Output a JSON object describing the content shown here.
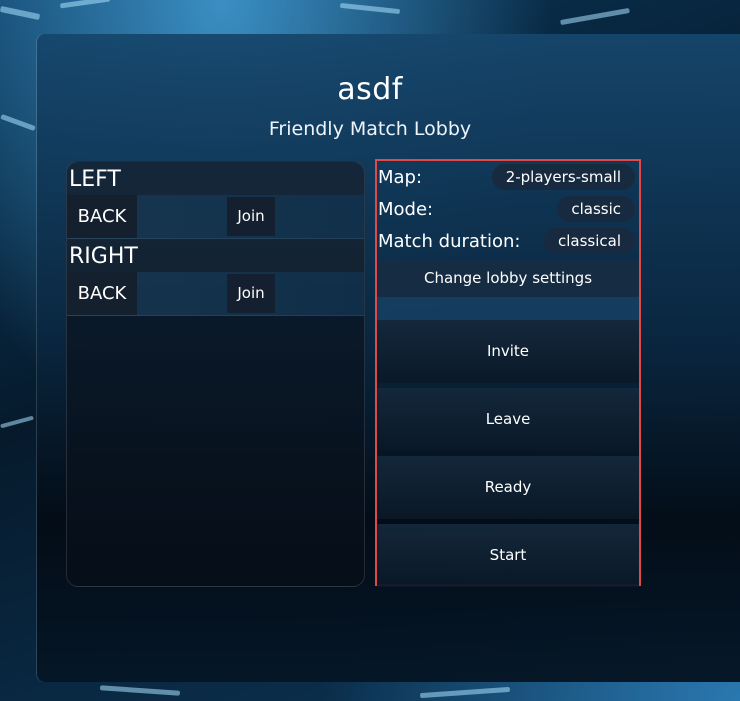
{
  "lobby": {
    "name": "asdf",
    "subtitle": "Friendly Match Lobby"
  },
  "teams": [
    {
      "name": "LEFT",
      "back_label": "BACK",
      "join_label": "Join"
    },
    {
      "name": "RIGHT",
      "back_label": "BACK",
      "join_label": "Join"
    }
  ],
  "settings": {
    "map_label": "Map:",
    "map_value": "2-players-small",
    "mode_label": "Mode:",
    "mode_value": "classic",
    "duration_label": "Match duration:",
    "duration_value": "classical",
    "change_label": "Change lobby settings"
  },
  "actions": {
    "invite_label": "Invite",
    "leave_label": "Leave",
    "ready_label": "Ready",
    "start_label": "Start"
  },
  "colors": {
    "highlight_border": "#e0494a",
    "background": "#061a2c"
  }
}
